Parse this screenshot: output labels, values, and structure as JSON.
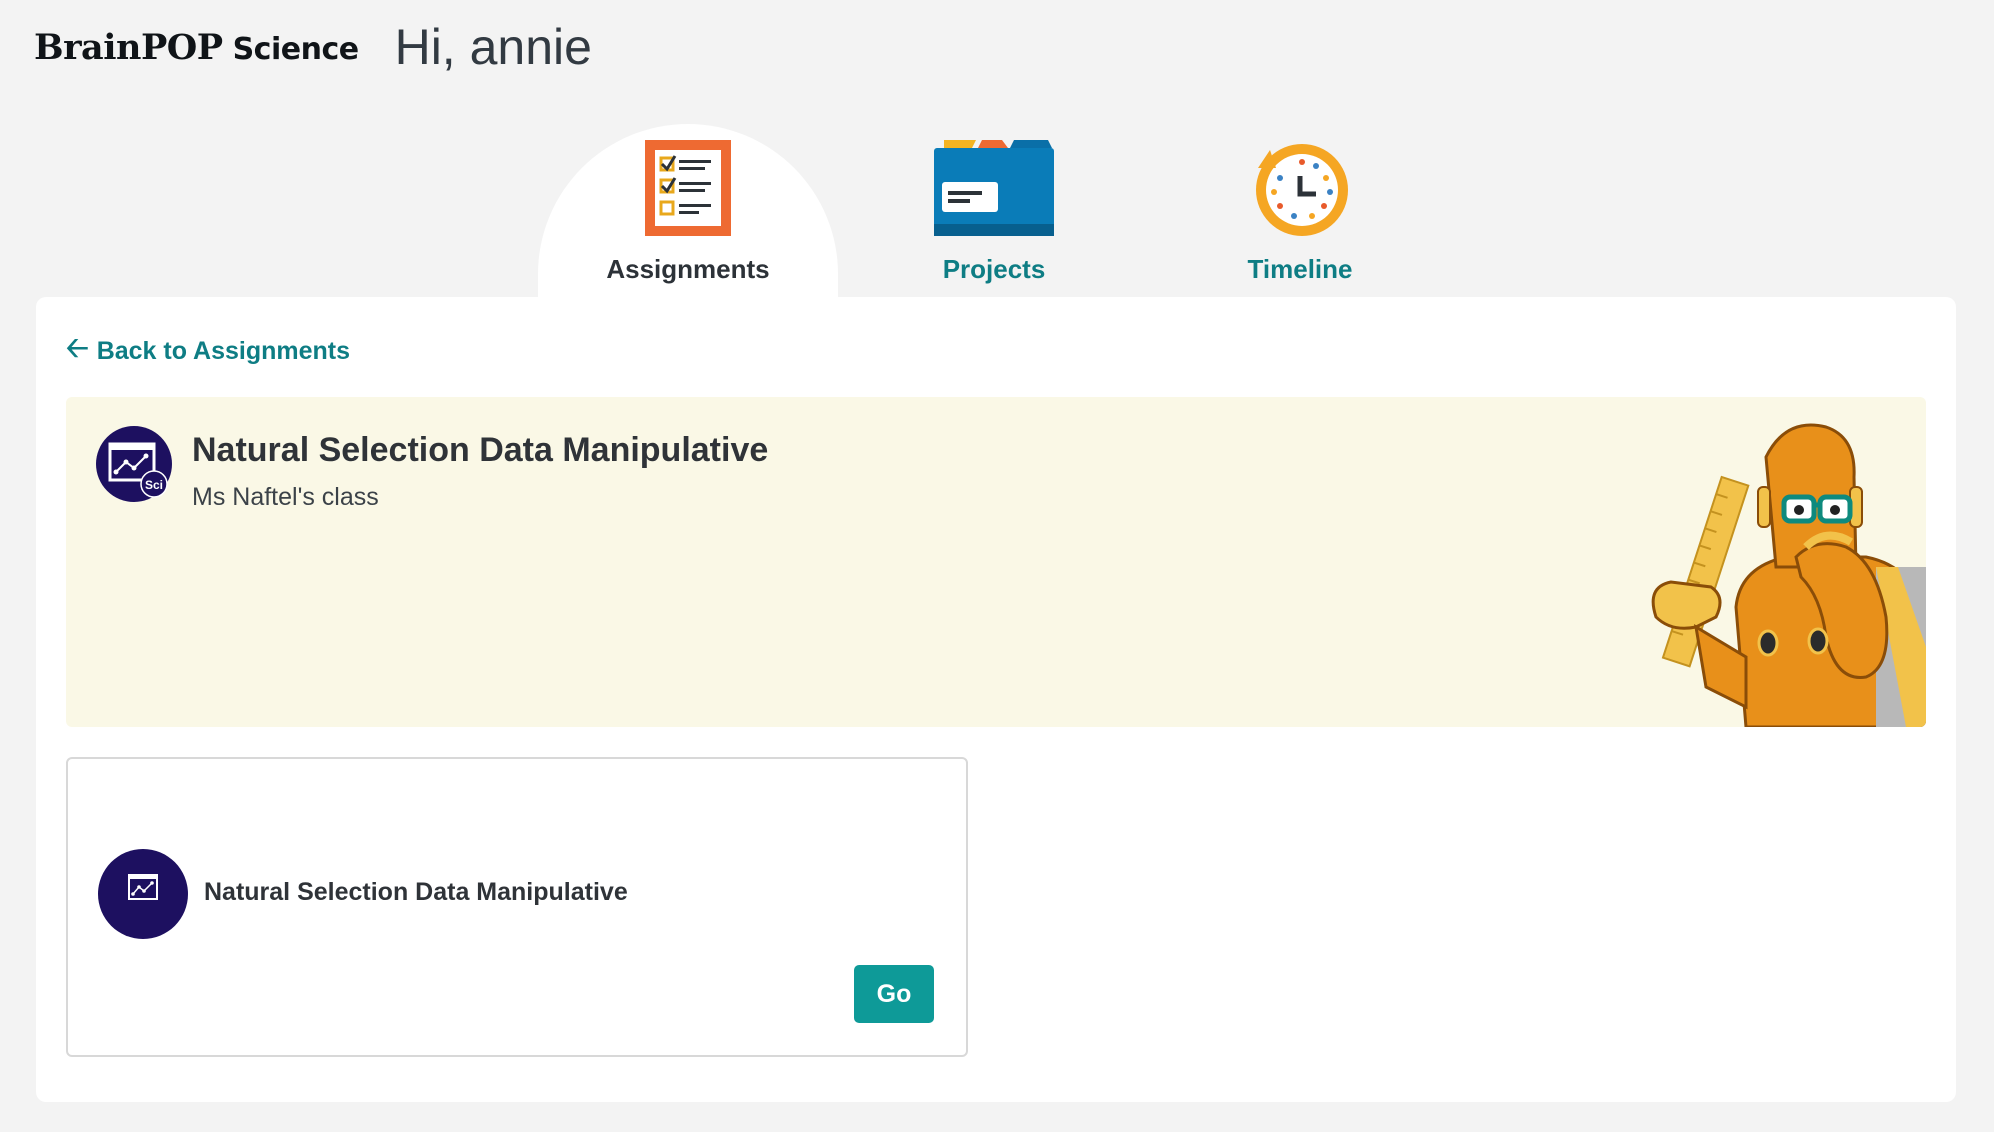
{
  "header": {
    "logo_brand": "BrainPOP",
    "logo_product": "Science",
    "greeting": "Hi, annie"
  },
  "tabs": [
    {
      "label": "Assignments",
      "icon": "assignments-checklist-icon",
      "active": true
    },
    {
      "label": "Projects",
      "icon": "projects-folder-icon",
      "active": false
    },
    {
      "label": "Timeline",
      "icon": "timeline-clock-icon",
      "active": false
    }
  ],
  "back_link": {
    "label": "Back to Assignments",
    "icon": "arrow-left-icon"
  },
  "banner": {
    "title": "Natural Selection Data Manipulative",
    "subtitle": "Ms Naftel's class",
    "icon": "data-manipulative-sci-icon",
    "icon_badge": "Sci",
    "mascot": "moby-robot-mascot"
  },
  "activity_card": {
    "title": "Natural Selection Data Manipulative",
    "icon": "data-manipulative-icon",
    "button_label": "Go"
  },
  "colors": {
    "teal": "#0e7d84",
    "button": "#0e9a98",
    "icon_bg": "#1d1060",
    "banner_bg": "#faf8e6",
    "page_bg": "#f3f3f3"
  }
}
